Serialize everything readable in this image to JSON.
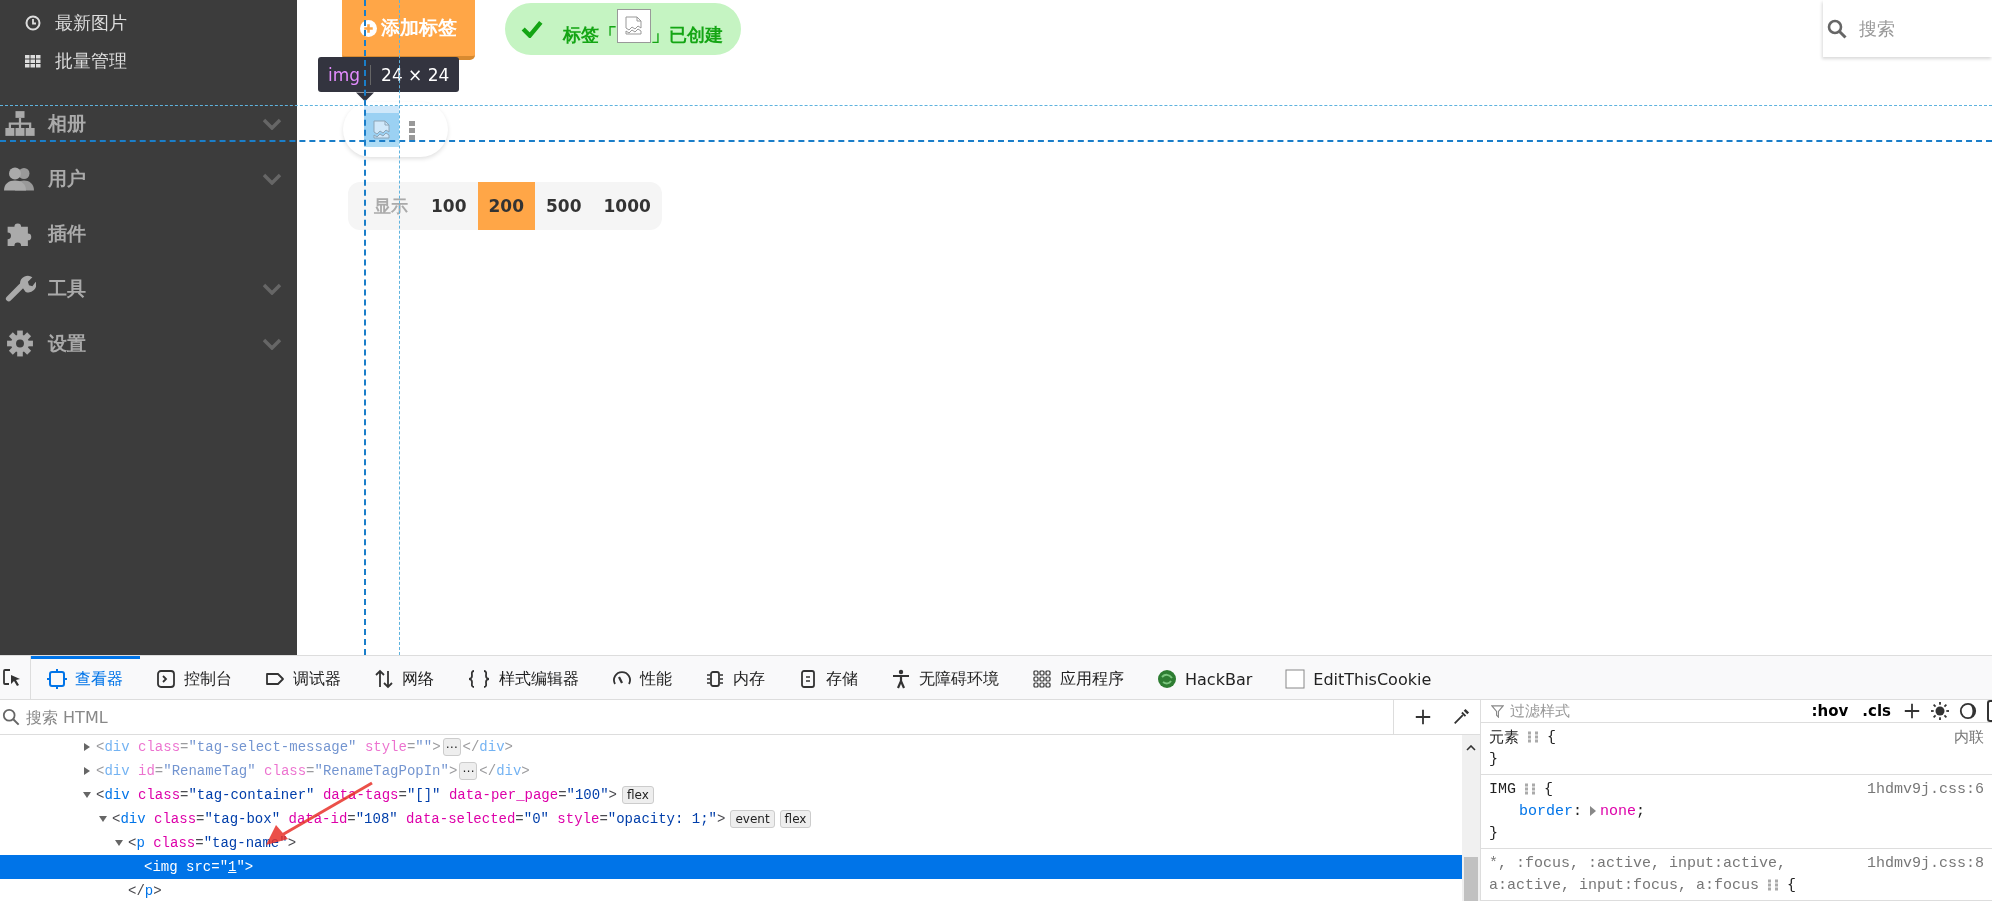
{
  "sidebar": {
    "sub_items": [
      {
        "label": "最新图片"
      },
      {
        "label": "批量管理"
      }
    ],
    "sections": [
      {
        "label": "相册",
        "has_submenu": true
      },
      {
        "label": "用户",
        "has_submenu": true
      },
      {
        "label": "插件",
        "has_submenu": false
      },
      {
        "label": "工具",
        "has_submenu": true
      },
      {
        "label": "设置",
        "has_submenu": true
      }
    ]
  },
  "main": {
    "add_button": "添加标签",
    "toast": {
      "text_before": "标签「",
      "text_after": "」已创建"
    },
    "search": {
      "placeholder": "搜索"
    },
    "tooltip": {
      "tag": "img",
      "size": "24 × 24"
    },
    "pager": {
      "label": "显示",
      "options": [
        {
          "label": "100",
          "selected": false
        },
        {
          "label": "200",
          "selected": true
        },
        {
          "label": "500",
          "selected": false
        },
        {
          "label": "1000",
          "selected": false
        }
      ]
    }
  },
  "devtools": {
    "tabs": [
      {
        "label": "查看器",
        "selected": true
      },
      {
        "label": "控制台",
        "selected": false
      },
      {
        "label": "调试器",
        "selected": false
      },
      {
        "label": "网络",
        "selected": false
      },
      {
        "label": "样式编辑器",
        "selected": false
      },
      {
        "label": "性能",
        "selected": false
      },
      {
        "label": "内存",
        "selected": false
      },
      {
        "label": "存储",
        "selected": false
      },
      {
        "label": "无障碍环境",
        "selected": false
      },
      {
        "label": "应用程序",
        "selected": false
      },
      {
        "label": "HackBar",
        "selected": false
      },
      {
        "label": "EditThisCookie",
        "selected": false
      }
    ],
    "html_search": {
      "placeholder": "搜索 HTML"
    },
    "tree": [
      {
        "hidden": true,
        "expanded": false,
        "selected": false,
        "open": [
          {
            "kind": "punct",
            "t": "<"
          },
          {
            "kind": "tag",
            "t": "div"
          },
          {
            "kind": "name",
            "t": " class"
          },
          {
            "kind": "punct",
            "t": "="
          },
          {
            "kind": "value",
            "t": "\"tag-select-message\""
          },
          {
            "kind": "name",
            "t": " style"
          },
          {
            "kind": "punct",
            "t": "="
          },
          {
            "kind": "value",
            "t": "\"\""
          },
          {
            "kind": "punct",
            "t": ">"
          }
        ],
        "inline_badge": "⋯",
        "inline_close": [
          {
            "kind": "punct",
            "t": "</"
          },
          {
            "kind": "tag",
            "t": "div"
          },
          {
            "kind": "punct",
            "t": ">"
          }
        ]
      },
      {
        "hidden": true,
        "expanded": false,
        "selected": false,
        "open": [
          {
            "kind": "punct",
            "t": "<"
          },
          {
            "kind": "tag",
            "t": "div"
          },
          {
            "kind": "name",
            "t": " id"
          },
          {
            "kind": "punct",
            "t": "="
          },
          {
            "kind": "value",
            "t": "\"RenameTag\""
          },
          {
            "kind": "name",
            "t": " class"
          },
          {
            "kind": "punct",
            "t": "="
          },
          {
            "kind": "value",
            "t": "\"RenameTagPopIn\""
          },
          {
            "kind": "punct",
            "t": ">"
          }
        ],
        "inline_badge": "⋯",
        "inline_close": [
          {
            "kind": "punct",
            "t": "</"
          },
          {
            "kind": "tag",
            "t": "div"
          },
          {
            "kind": "punct",
            "t": ">"
          }
        ]
      },
      {
        "hidden": false,
        "expanded": true,
        "selected": false,
        "open": [
          {
            "kind": "punct",
            "t": "<"
          },
          {
            "kind": "tag",
            "t": "div"
          },
          {
            "kind": "name",
            "t": " class"
          },
          {
            "kind": "punct",
            "t": "="
          },
          {
            "kind": "value",
            "t": "\"tag-container\""
          },
          {
            "kind": "name",
            "t": " data-tags"
          },
          {
            "kind": "punct",
            "t": "="
          },
          {
            "kind": "value",
            "t": "\"[]\""
          },
          {
            "kind": "name",
            "t": " data-per_page"
          },
          {
            "kind": "punct",
            "t": "="
          },
          {
            "kind": "value",
            "t": "\"100\""
          },
          {
            "kind": "punct",
            "t": ">"
          }
        ],
        "badges": [
          "flex"
        ],
        "children": [
          {
            "hidden": false,
            "expanded": true,
            "selected": false,
            "open": [
              {
                "kind": "punct",
                "t": "<"
              },
              {
                "kind": "tag",
                "t": "div"
              },
              {
                "kind": "name",
                "t": " class"
              },
              {
                "kind": "punct",
                "t": "="
              },
              {
                "kind": "value",
                "t": "\"tag-box\""
              },
              {
                "kind": "name",
                "t": " data-id"
              },
              {
                "kind": "punct",
                "t": "="
              },
              {
                "kind": "value",
                "t": "\"108\""
              },
              {
                "kind": "name",
                "t": " data-selected"
              },
              {
                "kind": "punct",
                "t": "="
              },
              {
                "kind": "value",
                "t": "\"0\""
              },
              {
                "kind": "name",
                "t": " style"
              },
              {
                "kind": "punct",
                "t": "="
              },
              {
                "kind": "value",
                "t": "\"opacity: 1;\""
              },
              {
                "kind": "punct",
                "t": ">"
              }
            ],
            "badges": [
              "event",
              "flex"
            ],
            "children": [
              {
                "hidden": false,
                "expanded": true,
                "selected": false,
                "open": [
                  {
                    "kind": "punct",
                    "t": "<"
                  },
                  {
                    "kind": "tag",
                    "t": "p"
                  },
                  {
                    "kind": "name",
                    "t": " class"
                  },
                  {
                    "kind": "punct",
                    "t": "="
                  },
                  {
                    "kind": "value",
                    "t": "\"tag-name\""
                  },
                  {
                    "kind": "punct",
                    "t": ">"
                  }
                ],
                "children": [
                  {
                    "hidden": false,
                    "selected": true,
                    "open": [
                      {
                        "kind": "punct",
                        "t": "<"
                      },
                      {
                        "kind": "tag",
                        "t": "img"
                      },
                      {
                        "kind": "name",
                        "t": " src"
                      },
                      {
                        "kind": "punct",
                        "t": "=\""
                      },
                      {
                        "kind": "link",
                        "t": "1"
                      },
                      {
                        "kind": "punct",
                        "t": "\">"
                      }
                    ]
                  }
                ],
                "close": [
                  {
                    "kind": "punct",
                    "t": "</"
                  },
                  {
                    "kind": "tag",
                    "t": "p"
                  },
                  {
                    "kind": "punct",
                    "t": ">"
                  }
                ]
              }
            ]
          }
        ]
      }
    ],
    "rules_filter": {
      "placeholder": "过滤样式"
    },
    "rules_buttons": [
      ":hov",
      ".cls"
    ],
    "rules": [
      {
        "selector_lines": [
          "元素"
        ],
        "open": "{",
        "source": "内联",
        "close": "}"
      },
      {
        "selector_lines": [
          "IMG"
        ],
        "open": "{",
        "source": "1hdmv9j.css:6",
        "declarations": [
          {
            "property": "border",
            "colon": ":",
            "value": "none",
            "end": ";"
          }
        ],
        "close": "}"
      },
      {
        "selector_lines": [
          "*, :focus, :active, input:active,",
          "a:active, input:focus, a:focus"
        ],
        "open": "{",
        "source": "1hdmv9j.css:8"
      }
    ]
  }
}
